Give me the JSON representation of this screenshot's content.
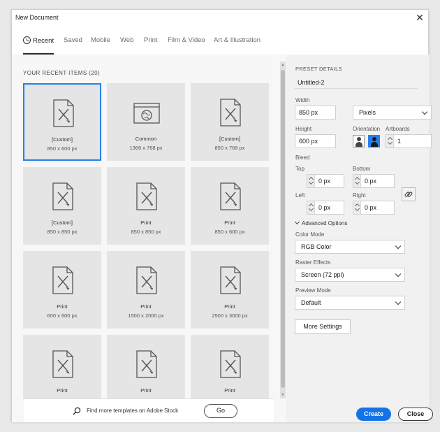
{
  "window": {
    "title": "New Document",
    "close_glyph": "✕"
  },
  "tabs": [
    {
      "label": "Recent",
      "icon": "clock-icon",
      "active": true
    },
    {
      "label": "Saved"
    },
    {
      "label": "Mobile"
    },
    {
      "label": "Web"
    },
    {
      "label": "Print"
    },
    {
      "label": "Film & Video"
    },
    {
      "label": "Art & Illustration"
    }
  ],
  "recent": {
    "heading": "YOUR RECENT ITEMS",
    "count": "(20)",
    "items": [
      {
        "name": "[Custom]",
        "size": "850 x 600 px",
        "icon": "document-icon",
        "selected": true
      },
      {
        "name": "Common",
        "size": "1366 x 768 px",
        "icon": "web-page-icon"
      },
      {
        "name": "[Custom]",
        "size": "850 x 768 px",
        "icon": "document-icon"
      },
      {
        "name": "[Custom]",
        "size": "850 x 850 px",
        "icon": "document-icon"
      },
      {
        "name": "Print",
        "size": "850 x 850 px",
        "icon": "document-icon"
      },
      {
        "name": "Print",
        "size": "850 x 600 px",
        "icon": "document-icon"
      },
      {
        "name": "Print",
        "size": "600 x 600 px",
        "icon": "document-icon"
      },
      {
        "name": "Print",
        "size": "1500 x 2000 px",
        "icon": "document-icon"
      },
      {
        "name": "Print",
        "size": "2500 x 3000 px",
        "icon": "document-icon"
      },
      {
        "name": "Print",
        "size": "",
        "icon": "document-icon"
      },
      {
        "name": "Print",
        "size": "",
        "icon": "document-icon"
      },
      {
        "name": "Print",
        "size": "",
        "icon": "document-icon"
      }
    ]
  },
  "stock": {
    "text": "Find more templates on Adobe Stock",
    "go_label": "Go"
  },
  "preset": {
    "section_label": "PRESET DETAILS",
    "name": "Untitled-2",
    "width_label": "Width",
    "width_value": "850 px",
    "units": "Pixels",
    "height_label": "Height",
    "height_value": "600 px",
    "orientation_label": "Orientation",
    "orientation": "landscape",
    "artboards_label": "Artboards",
    "artboards_value": "1",
    "bleed_label": "Bleed",
    "top_label": "Top",
    "top_value": "0 px",
    "bottom_label": "Bottom",
    "bottom_value": "0 px",
    "left_label": "Left",
    "left_value": "0 px",
    "right_label": "Right",
    "right_value": "0 px",
    "advanced_label": "Advanced Options",
    "color_mode_label": "Color Mode",
    "color_mode_value": "RGB Color",
    "raster_label": "Raster Effects",
    "raster_value": "Screen (72 ppi)",
    "preview_label": "Preview Mode",
    "preview_value": "Default",
    "more_settings": "More Settings",
    "create": "Create",
    "close": "Close"
  },
  "colors": {
    "accent": "#1473e6",
    "selection": "#2680eb"
  }
}
